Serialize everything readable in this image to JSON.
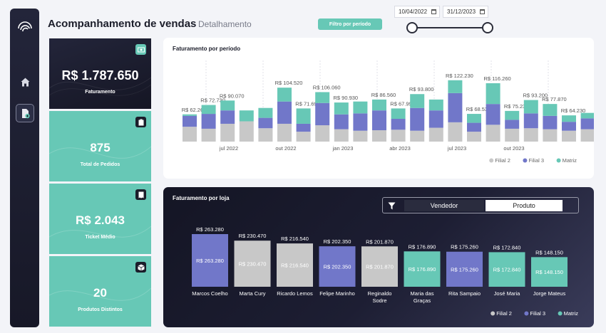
{
  "header": {
    "title": "Acompanhamento de vendas",
    "subtitle": "Detalhamento",
    "filter_button": "Filtro por período",
    "date_start": "10/04/2022",
    "date_end": "31/12/2023"
  },
  "sidebar": {
    "items": [
      {
        "icon": "home-icon"
      },
      {
        "icon": "report-icon",
        "active": true
      }
    ]
  },
  "kpis": [
    {
      "value": "R$ 1.787.650",
      "label": "Faturamento",
      "icon": "money-icon"
    },
    {
      "value": "875",
      "label": "Total de Pedidos",
      "icon": "clipboard-icon"
    },
    {
      "value": "R$ 2.043",
      "label": "Ticket Médio",
      "icon": "receipt-icon"
    },
    {
      "value": "20",
      "label": "Produtos Distintos",
      "icon": "box-icon"
    }
  ],
  "colors": {
    "filial2": "#c8c8c8",
    "filial3": "#7177c9",
    "matriz": "#67c8b6",
    "dark": "#1b1d2a"
  },
  "legend": [
    "Filial 2",
    "Filial 3",
    "Matriz"
  ],
  "chart_data": [
    {
      "title": "Faturamento por período",
      "type": "bar",
      "stacked": true,
      "x_tick_labels": [
        "jul 2022",
        "out 2022",
        "jan 2023",
        "abr 2023",
        "jul 2023",
        "out 2023"
      ],
      "totals": [
        62260,
        72730,
        90070,
        null,
        null,
        104520,
        71690,
        106060,
        90930,
        null,
        86560,
        67990,
        93800,
        null,
        122230,
        68530,
        116260,
        75230,
        93200,
        77870,
        64230,
        null
      ],
      "total_labels": [
        "R$ 62.260",
        "R$ 72.730",
        "R$ 90.070",
        "",
        "",
        "R$ 104.520",
        "R$ 71.690",
        "R$ 106.060",
        "R$ 90.930",
        "",
        "R$ 86.560",
        "R$ 67.990",
        "R$ 93.800",
        "",
        "R$ 122.230",
        "R$ 68.530",
        "R$ 116.260",
        "R$ 75.230",
        "R$ 93.200",
        "R$ 77.870",
        "R$ 64.230",
        ""
      ],
      "series": [
        {
          "name": "Filial 2",
          "values": [
            30000,
            26000,
            36000,
            41000,
            27000,
            36000,
            20000,
            33000,
            25000,
            22000,
            23000,
            24000,
            22000,
            28000,
            39000,
            20000,
            34000,
            26000,
            27000,
            25000,
            22000,
            25000
          ]
        },
        {
          "name": "Filial 3",
          "values": [
            22000,
            30000,
            27000,
            0,
            21000,
            45000,
            16000,
            45000,
            30000,
            35000,
            40000,
            22000,
            46000,
            35000,
            59000,
            18000,
            42000,
            18000,
            30000,
            27000,
            18000,
            22000
          ]
        },
        {
          "name": "Matriz",
          "values": [
            3000,
            18000,
            20000,
            22000,
            20000,
            28000,
            31000,
            22000,
            24000,
            24000,
            22000,
            21000,
            28000,
            22000,
            26000,
            18000,
            42000,
            18000,
            27000,
            24000,
            13000,
            11000
          ]
        }
      ]
    },
    {
      "title": "Faturamento por loja",
      "type": "bar",
      "categories": [
        "Marcos Coelho",
        "Marta Cury",
        "Ricardo Lemos",
        "Felipe Marinho",
        "Reginaldo Sodre",
        "Maria das Graças",
        "Rita Sampaio",
        "José Maria",
        "Jorge Mateus"
      ],
      "values": [
        263280,
        230470,
        216540,
        202350,
        201870,
        176890,
        175260,
        172840,
        148150
      ],
      "value_labels": [
        "R$ 263.280",
        "R$ 230.470",
        "R$ 216.540",
        "R$ 202.350",
        "R$ 201.870",
        "R$ 176.890",
        "R$ 175.260",
        "R$ 172.840",
        "R$ 148.150"
      ],
      "filial": [
        "Filial 3",
        "Filial 2",
        "Filial 2",
        "Filial 3",
        "Filial 2",
        "Matriz",
        "Filial 3",
        "Matriz",
        "Matriz"
      ],
      "toggle": {
        "options": [
          "Vendedor",
          "Produto"
        ],
        "selected": "Vendedor"
      }
    }
  ]
}
